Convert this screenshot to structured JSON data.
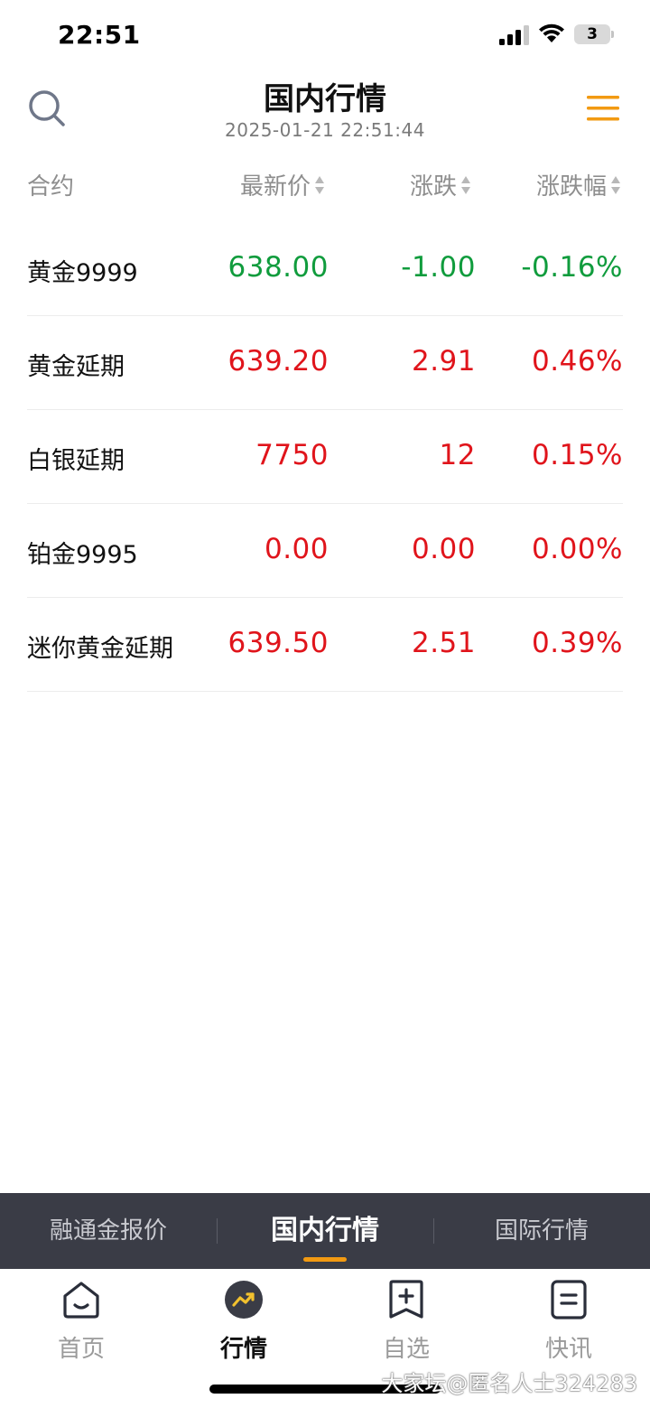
{
  "status_bar": {
    "time": "22:51",
    "battery": "3"
  },
  "header": {
    "title": "国内行情",
    "timestamp": "2025-01-21 22:51:44"
  },
  "columns": {
    "contract": "合约",
    "price": "最新价",
    "change": "涨跌",
    "pct": "涨跌幅"
  },
  "colors": {
    "up": "#e0141b",
    "down": "#109c3d",
    "accent": "#f29a12"
  },
  "rows": [
    {
      "name": "黄金9999",
      "price": "638.00",
      "change": "-1.00",
      "pct": "-0.16%",
      "trend": "down"
    },
    {
      "name": "黄金延期",
      "price": "639.20",
      "change": "2.91",
      "pct": "0.46%",
      "trend": "up"
    },
    {
      "name": "白银延期",
      "price": "7750",
      "change": "12",
      "pct": "0.15%",
      "trend": "up"
    },
    {
      "name": "铂金9995",
      "price": "0.00",
      "change": "0.00",
      "pct": "0.00%",
      "trend": "up"
    },
    {
      "name": "迷你黄金延期",
      "price": "639.50",
      "change": "2.51",
      "pct": "0.39%",
      "trend": "up"
    }
  ],
  "subtabs": [
    {
      "label": "融通金报价",
      "active": false
    },
    {
      "label": "国内行情",
      "active": true
    },
    {
      "label": "国际行情",
      "active": false
    }
  ],
  "bottom_nav": [
    {
      "label": "首页",
      "icon": "home-icon",
      "active": false
    },
    {
      "label": "行情",
      "icon": "market-icon",
      "active": true
    },
    {
      "label": "自选",
      "icon": "watchlist-add-icon",
      "active": false
    },
    {
      "label": "快讯",
      "icon": "news-flash-icon",
      "active": false
    }
  ],
  "watermark": "大家坛@匿名人士324283"
}
